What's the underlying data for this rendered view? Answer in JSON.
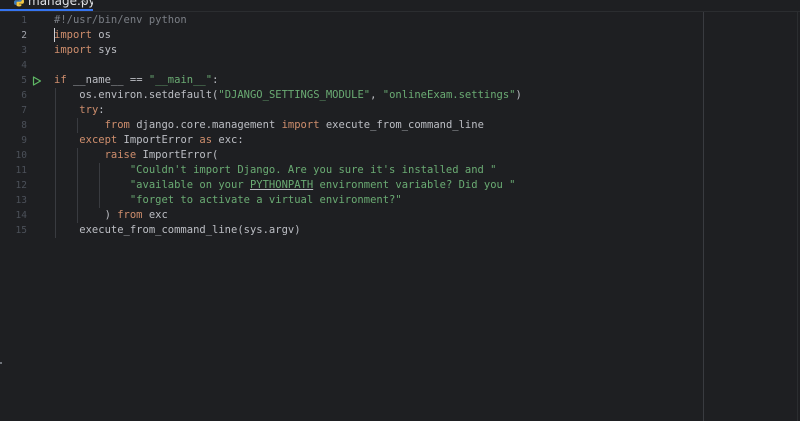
{
  "tab": {
    "file_name": "manage.py",
    "close_glyph": "×",
    "icon": "python-file-icon"
  },
  "editor": {
    "current_line": 2,
    "run_line": 5,
    "lines": [
      {
        "n": "1",
        "text": "#!/usr/bin/env python"
      },
      {
        "n": "2",
        "text": "import os"
      },
      {
        "n": "3",
        "text": "import sys"
      },
      {
        "n": "4",
        "text": ""
      },
      {
        "n": "5",
        "text": "if __name__ == \"__main__\":"
      },
      {
        "n": "6",
        "text": "    os.environ.setdefault(\"DJANGO_SETTINGS_MODULE\", \"onlineExam.settings\")"
      },
      {
        "n": "7",
        "text": "    try:"
      },
      {
        "n": "8",
        "text": "        from django.core.management import execute_from_command_line"
      },
      {
        "n": "9",
        "text": "    except ImportError as exc:"
      },
      {
        "n": "10",
        "text": "        raise ImportError("
      },
      {
        "n": "11",
        "text": "            \"Couldn't import Django. Are you sure it's installed and \""
      },
      {
        "n": "12",
        "text": "            \"available on your PYTHONPATH environment variable? Did you \""
      },
      {
        "n": "13",
        "text": "            \"forget to activate a virtual environment?\""
      },
      {
        "n": "14",
        "text": "        ) from exc"
      },
      {
        "n": "15",
        "text": "    execute_from_command_line(sys.argv)"
      }
    ]
  },
  "colors": {
    "background": "#1e1f22",
    "keyword": "#cf8e6d",
    "string": "#6aab73",
    "comment": "#7a7e85",
    "text": "#bcbec4",
    "line_number": "#4b5059",
    "tab_accent": "#3574f0",
    "run_icon": "#5fb865"
  }
}
